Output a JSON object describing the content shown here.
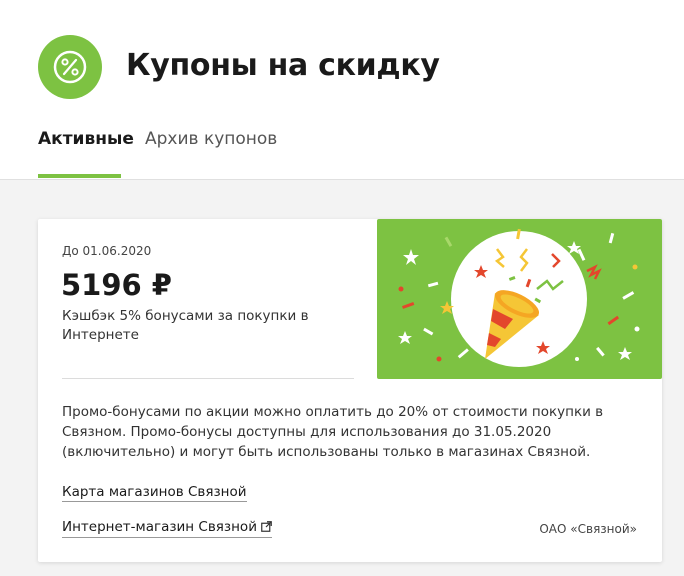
{
  "header": {
    "title": "Купоны на скидку",
    "logo_icon": "percent-icon",
    "accent_color": "#7dc242"
  },
  "tabs": [
    {
      "label": "Активные",
      "active": true
    },
    {
      "label": "Архив купонов",
      "active": false
    }
  ],
  "coupon": {
    "valid_until": "До 01.06.2020",
    "amount": "5196 ₽",
    "cashback": "Кэшбэк 5% бонусами за покупки в Интернете",
    "image_icon": "party-popper-icon",
    "description": "Промо-бонусами по акции можно оплатить до 20% от стоимости покупки в Связном. Промо-бонусы доступны для использования до 31.05.2020 (включительно) и могут быть использованы только в магазинах Связной.",
    "links": {
      "stores": "Карта магазинов Связной",
      "online_shop": "Интернет-магазин Связной"
    },
    "company": "ОАО «Связной»"
  }
}
